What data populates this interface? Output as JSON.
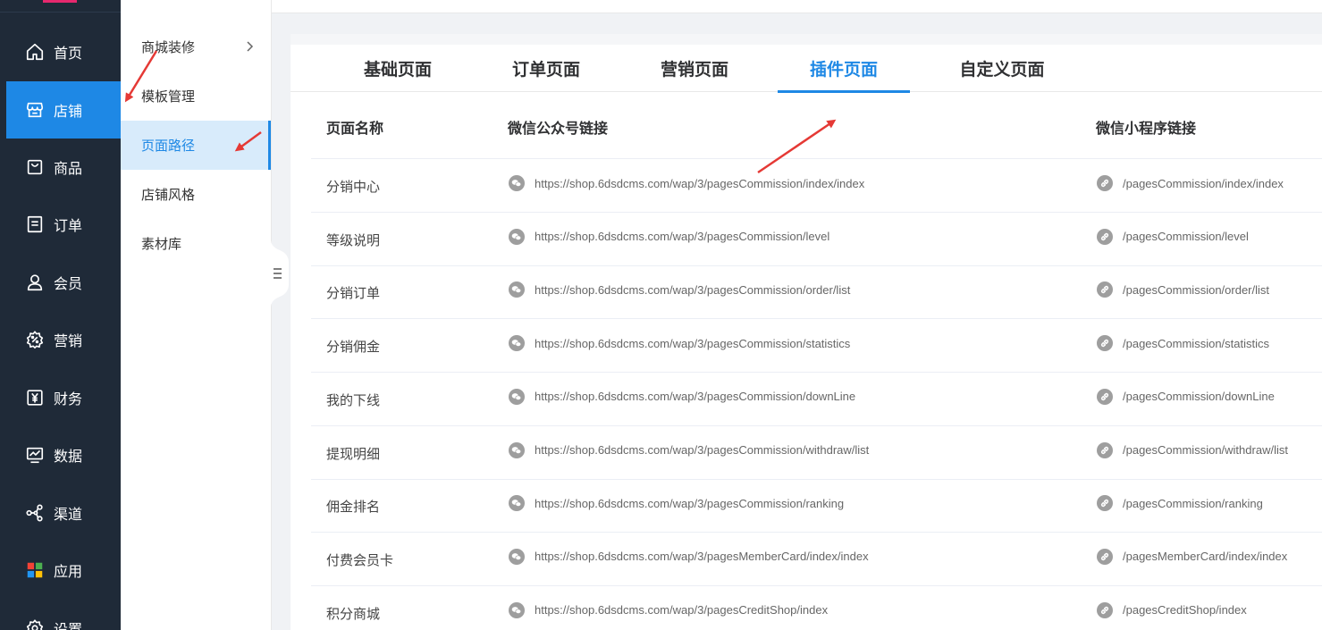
{
  "sidebar": {
    "items": [
      {
        "label": "首页",
        "icon": "home-icon"
      },
      {
        "label": "店铺",
        "icon": "store-icon",
        "active": true
      },
      {
        "label": "商品",
        "icon": "bag-icon"
      },
      {
        "label": "订单",
        "icon": "order-icon"
      },
      {
        "label": "会员",
        "icon": "user-icon"
      },
      {
        "label": "营销",
        "icon": "marketing-gear-icon"
      },
      {
        "label": "财务",
        "icon": "yuan-icon"
      },
      {
        "label": "数据",
        "icon": "monitor-chart-icon"
      },
      {
        "label": "渠道",
        "icon": "share-icon"
      },
      {
        "label": "应用",
        "icon": "apps-grid-icon"
      },
      {
        "label": "设置",
        "icon": "settings-icon"
      }
    ]
  },
  "submenu": {
    "items": [
      {
        "label": "商城装修",
        "has_chevron": true
      },
      {
        "label": "模板管理"
      },
      {
        "label": "页面路径",
        "active": true
      },
      {
        "label": "店铺风格"
      },
      {
        "label": "素材库"
      }
    ]
  },
  "tabs": [
    {
      "label": "基础页面"
    },
    {
      "label": "订单页面"
    },
    {
      "label": "营销页面"
    },
    {
      "label": "插件页面",
      "active": true
    },
    {
      "label": "自定义页面"
    }
  ],
  "table": {
    "headers": {
      "name": "页面名称",
      "wechat": "微信公众号链接",
      "miniprogram": "微信小程序链接"
    },
    "rows": [
      {
        "name": "分销中心",
        "wechat": "https://shop.6dsdcms.com/wap/3/pagesCommission/index/index",
        "miniprogram": "/pagesCommission/index/index"
      },
      {
        "name": "等级说明",
        "wechat": "https://shop.6dsdcms.com/wap/3/pagesCommission/level",
        "miniprogram": "/pagesCommission/level"
      },
      {
        "name": "分销订单",
        "wechat": "https://shop.6dsdcms.com/wap/3/pagesCommission/order/list",
        "miniprogram": "/pagesCommission/order/list"
      },
      {
        "name": "分销佣金",
        "wechat": "https://shop.6dsdcms.com/wap/3/pagesCommission/statistics",
        "miniprogram": "/pagesCommission/statistics"
      },
      {
        "name": "我的下线",
        "wechat": "https://shop.6dsdcms.com/wap/3/pagesCommission/downLine",
        "miniprogram": "/pagesCommission/downLine"
      },
      {
        "name": "提现明细",
        "wechat": "https://shop.6dsdcms.com/wap/3/pagesCommission/withdraw/list",
        "miniprogram": "/pagesCommission/withdraw/list"
      },
      {
        "name": "佣金排名",
        "wechat": "https://shop.6dsdcms.com/wap/3/pagesCommission/ranking",
        "miniprogram": "/pagesCommission/ranking"
      },
      {
        "name": "付费会员卡",
        "wechat": "https://shop.6dsdcms.com/wap/3/pagesMemberCard/index/index",
        "miniprogram": "/pagesMemberCard/index/index"
      },
      {
        "name": "积分商城",
        "wechat": "https://shop.6dsdcms.com/wap/3/pagesCreditShop/index",
        "miniprogram": "/pagesCreditShop/index"
      }
    ]
  },
  "colors": {
    "sidebar_bg": "#1f2a38",
    "accent": "#1e88e5",
    "submenu_active_bg": "#d8ebfb",
    "annotation_arrow": "#e53935"
  }
}
